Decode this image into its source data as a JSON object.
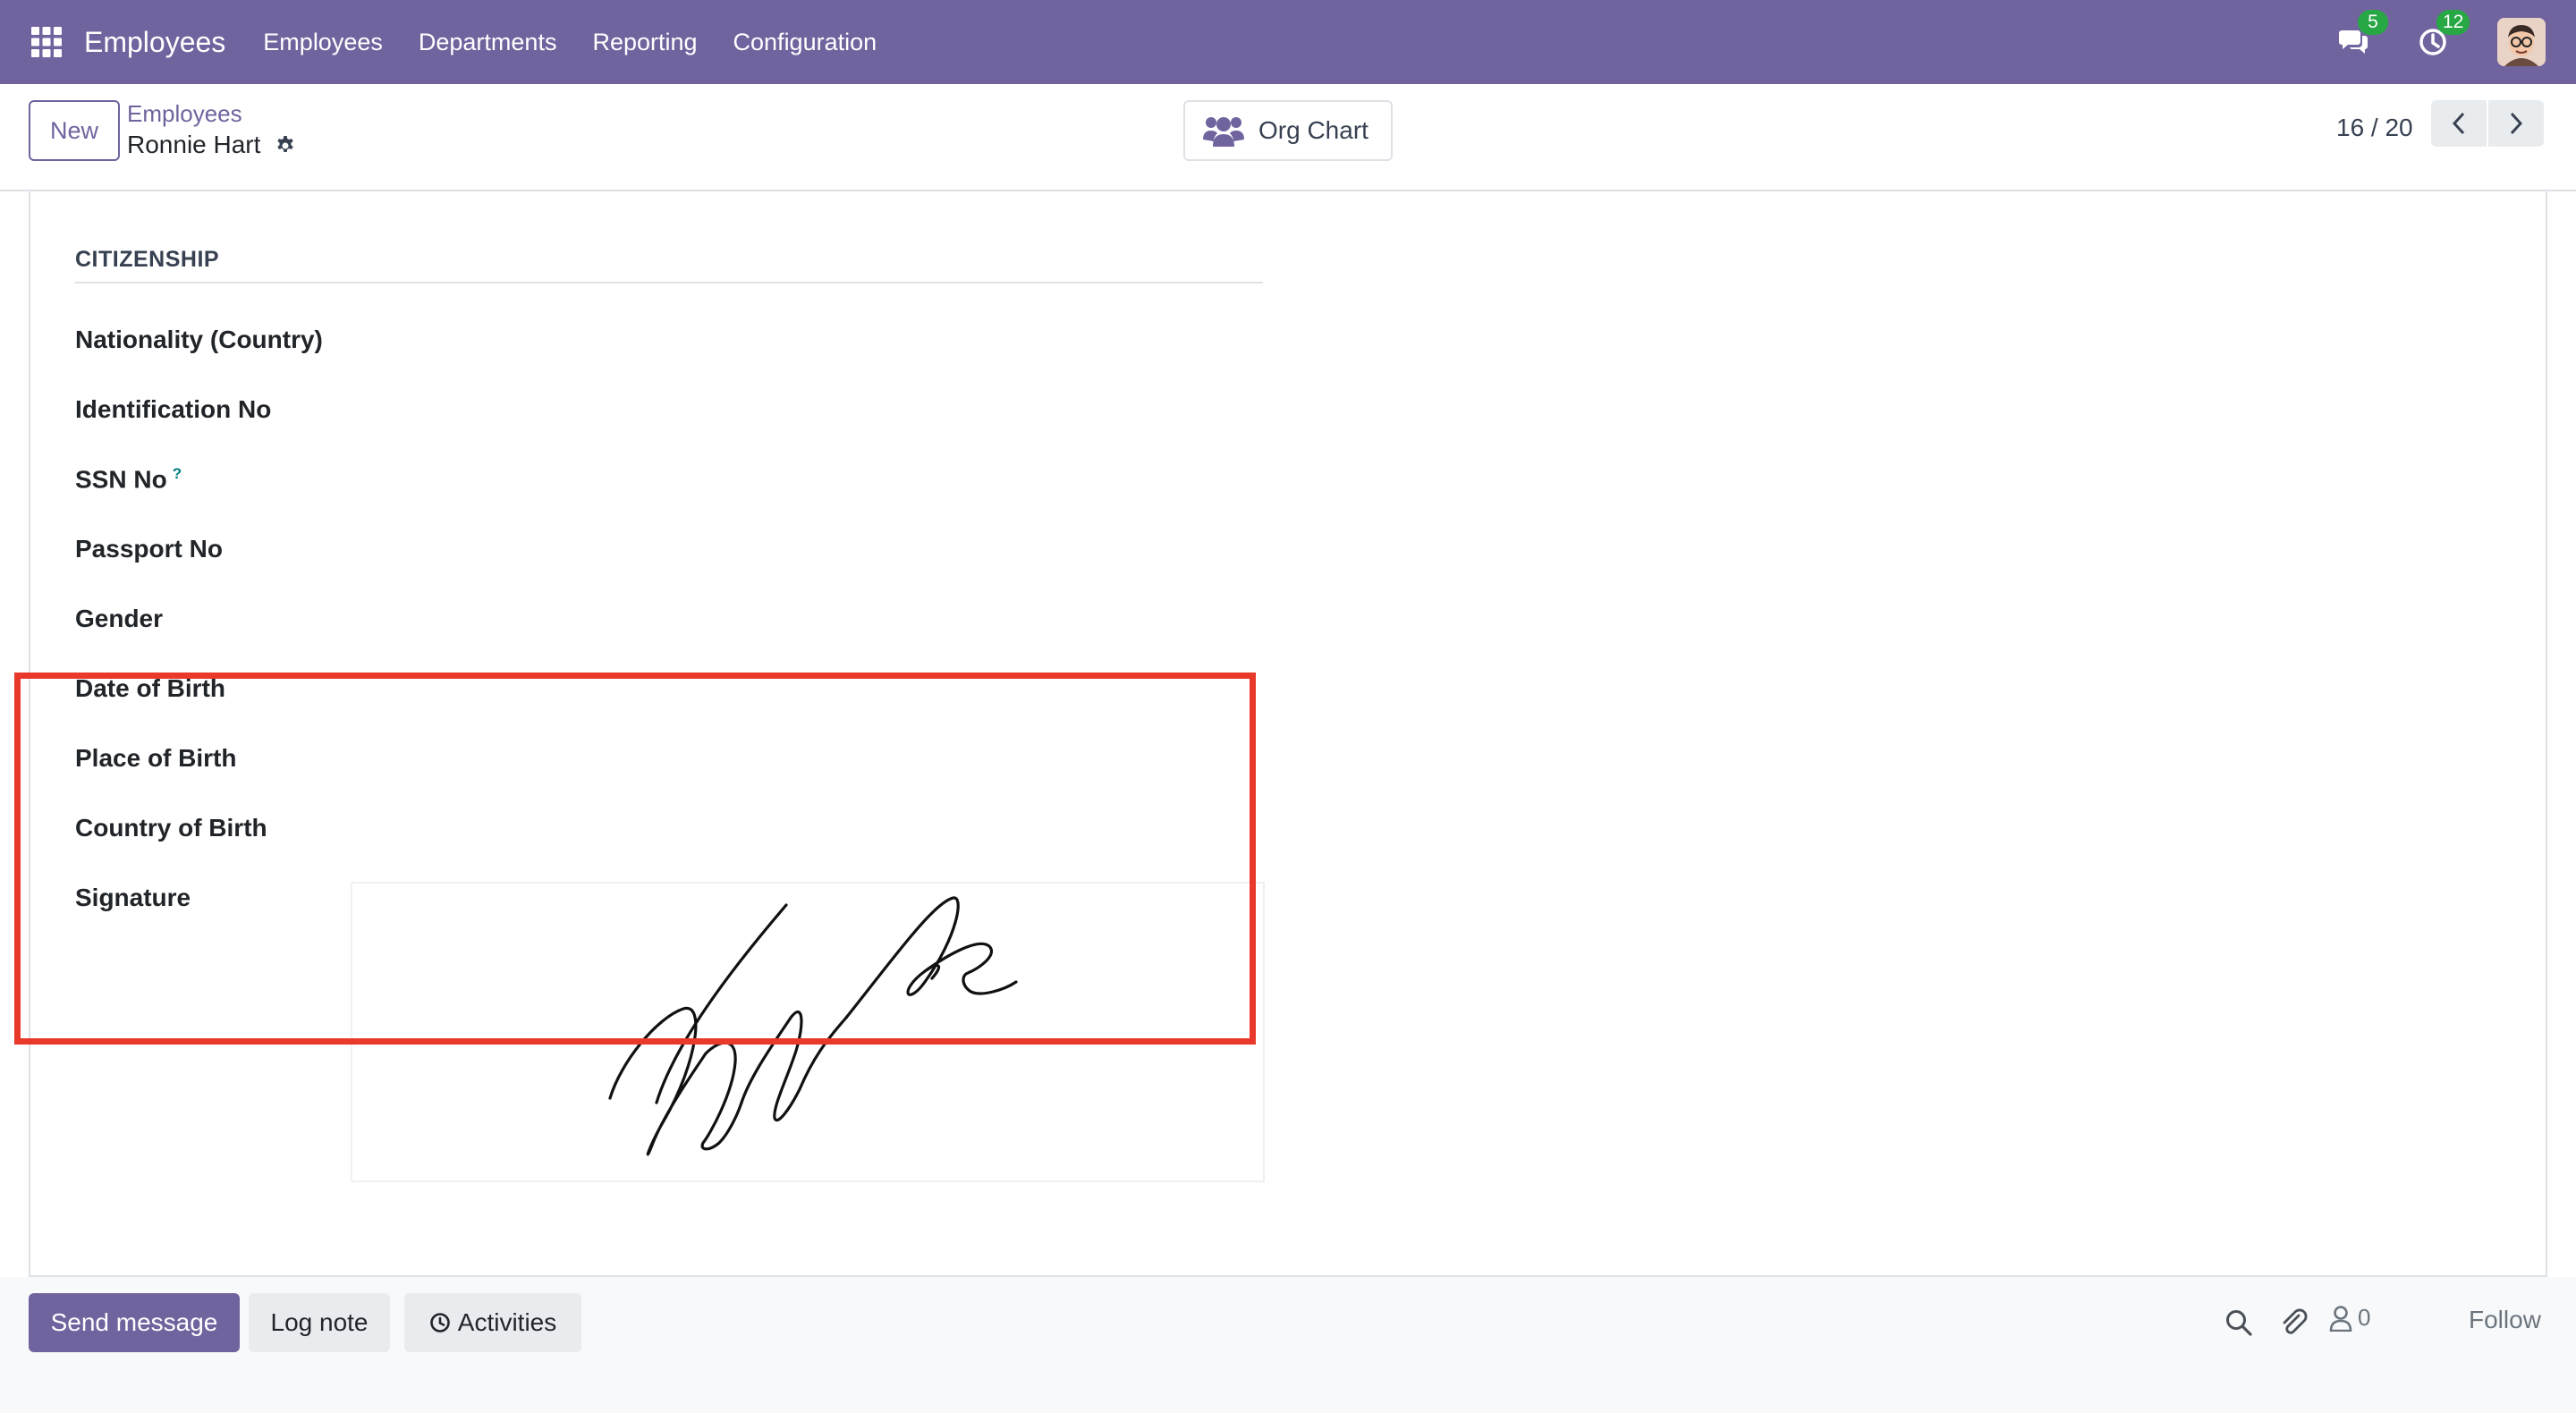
{
  "navbar": {
    "app_title": "Employees",
    "menu": [
      "Employees",
      "Departments",
      "Reporting",
      "Configuration"
    ],
    "messages_badge": "5",
    "activities_badge": "12",
    "icons": [
      "apps-grid-icon",
      "chat-icon",
      "clock-icon",
      "user-avatar"
    ],
    "color": "#71639e"
  },
  "control_panel": {
    "new_label": "New",
    "breadcrumb_parent": "Employees",
    "record_name": "Ronnie Hart",
    "org_chart_label": "Org Chart",
    "pager_value": "16 / 20"
  },
  "form": {
    "section_title": "CITIZENSHIP",
    "fields": {
      "nationality": "Nationality (Country)",
      "identification": "Identification No",
      "ssn": "SSN No",
      "ssn_help": "?",
      "passport": "Passport No",
      "gender": "Gender",
      "date_of_birth": "Date of Birth",
      "place_of_birth": "Place of Birth",
      "country_of_birth": "Country of Birth",
      "signature": "Signature"
    },
    "signature_signed_name": "Ronnie Hart",
    "highlight_color": "#e8392b"
  },
  "chatter": {
    "send_message": "Send message",
    "log_note": "Log note",
    "activities": "Activities",
    "follower_count": "0",
    "follow": "Follow"
  }
}
